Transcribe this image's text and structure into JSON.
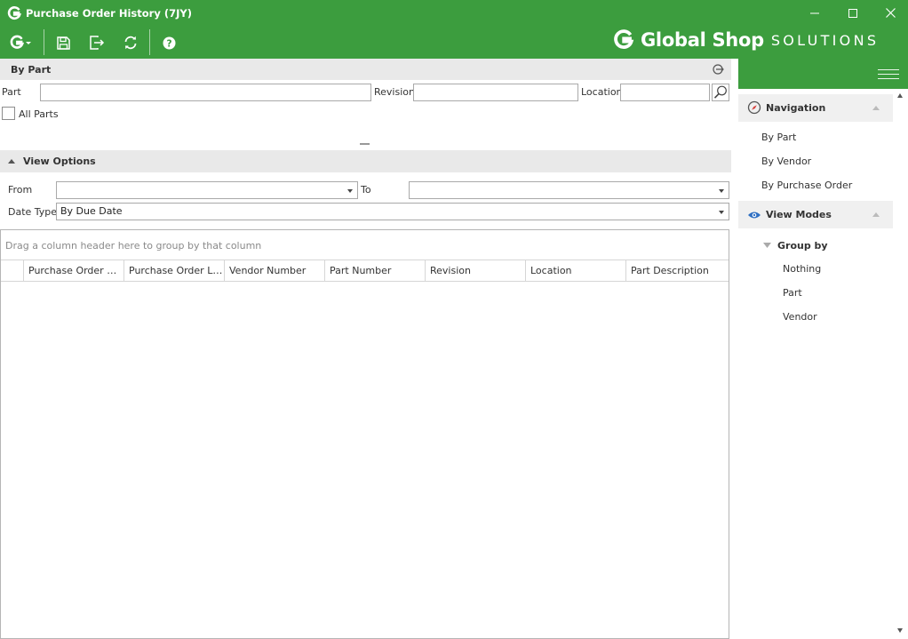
{
  "window": {
    "title": "Purchase Order History (7JY)",
    "minimize_icon": "minimize-icon",
    "maximize_icon": "maximize-icon",
    "close_icon": "close-icon"
  },
  "toolbar": {
    "items": [
      "menu-g-icon",
      "save-icon",
      "exit-icon",
      "refresh-icon",
      "help-icon"
    ]
  },
  "brand": {
    "global_shop": "Global Shop",
    "solutions": "SOLUTIONS",
    "color": "#3c9d3e"
  },
  "by_part": {
    "title": "By Part",
    "part_label": "Part",
    "part_value": "",
    "revision_label": "Revision",
    "revision_value": "",
    "location_label": "Location",
    "location_value": "",
    "all_parts_label": "All Parts"
  },
  "view_options": {
    "title": "View Options",
    "from_label": "From",
    "from_value": "",
    "to_label": "To",
    "to_value": "",
    "date_type_label": "Date Type",
    "date_type_value": "By Due Date"
  },
  "grid": {
    "group_hint": "Drag a column header here to group by that column",
    "columns": [
      "Purchase Order Nu...",
      "Purchase Order Lin...",
      "Vendor Number",
      "Part Number",
      "Revision",
      "Location",
      "Part Description"
    ]
  },
  "side": {
    "navigation": {
      "title": "Navigation",
      "items": [
        "By Part",
        "By Vendor",
        "By Purchase Order"
      ]
    },
    "view_modes": {
      "title": "View Modes",
      "group_by_label": "Group by",
      "group_by_items": [
        "Nothing",
        "Part",
        "Vendor"
      ]
    }
  }
}
